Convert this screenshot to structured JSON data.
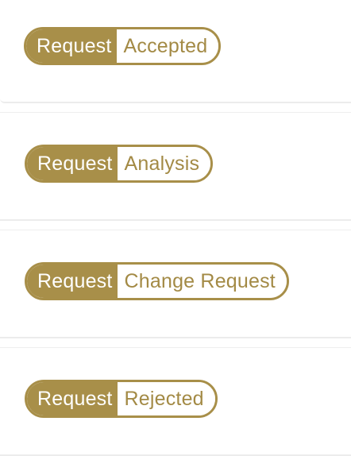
{
  "badges": [
    {
      "label": "Request",
      "value": "Accepted"
    },
    {
      "label": "Request",
      "value": "Analysis"
    },
    {
      "label": "Request",
      "value": "Change Request"
    },
    {
      "label": "Request",
      "value": "Rejected"
    }
  ],
  "colors": {
    "accent": "#a88f49",
    "value_text": "#a38a45",
    "card_border": "#eeeeee"
  }
}
